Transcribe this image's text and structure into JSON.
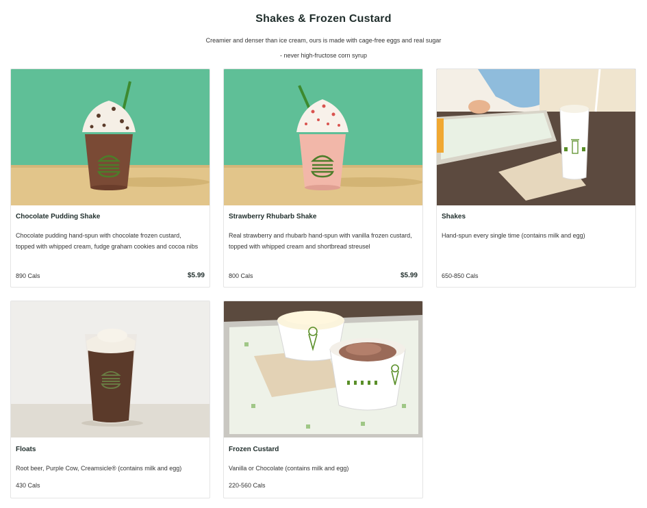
{
  "header": {
    "title": "Shakes & Frozen Custard",
    "description": "Creamier and denser than ice cream, ours is made with cage-free eggs and real sugar - never high-fructose corn syrup"
  },
  "items": [
    {
      "name": "Chocolate Pudding Shake",
      "description": "Chocolate pudding hand-spun with chocolate frozen custard, topped with whipped cream, fudge graham cookies and cocoa nibs",
      "calories": "890 Cals",
      "price": "$5.99"
    },
    {
      "name": "Strawberry Rhubarb Shake",
      "description": "Real strawberry and rhubarb hand-spun with vanilla frozen custard, topped with whipped cream and shortbread streusel",
      "calories": "800 Cals",
      "price": "$5.99"
    },
    {
      "name": "Shakes",
      "description": "Hand-spun every single time (contains milk and egg)",
      "calories": "650-850 Cals"
    },
    {
      "name": "Floats",
      "description": "Root beer, Purple Cow, Creamsicle® (contains milk and egg)",
      "calories": "430 Cals"
    },
    {
      "name": "Frozen Custard",
      "description": "Vanilla or Chocolate (contains milk and egg)",
      "calories": "220-560 Cals"
    }
  ],
  "colors": {
    "mint_background": "#5fbf97",
    "wood_table": "#e2c58a",
    "brand_green": "#5a8f29",
    "text_dark": "#1f2d2b"
  }
}
